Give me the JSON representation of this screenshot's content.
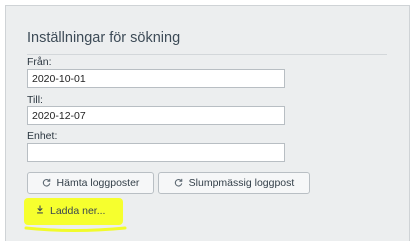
{
  "panel": {
    "title": "Inställningar för sökning"
  },
  "fields": {
    "from": {
      "label": "Från:",
      "value": "2020-10-01"
    },
    "to": {
      "label": "Till:",
      "value": "2020-12-07"
    },
    "unit": {
      "label": "Enhet:",
      "value": ""
    }
  },
  "buttons": {
    "fetch_logs": {
      "label": "Hämta loggposter",
      "icon": "refresh-icon"
    },
    "random_log": {
      "label": "Slumpmässig loggpost",
      "icon": "refresh-icon"
    },
    "download": {
      "label": "Ladda ner...",
      "icon": "download-icon"
    }
  },
  "colors": {
    "highlight": "#f6ff2e",
    "panel_bg": "#eceeef"
  }
}
